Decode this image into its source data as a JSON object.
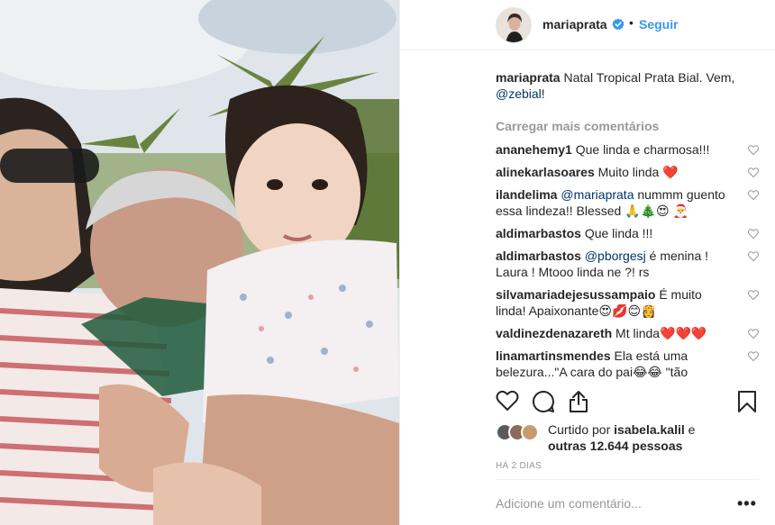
{
  "post": {
    "photo_alt": "family-selfie-photo",
    "header": {
      "username": "mariaprata",
      "dot": "•",
      "follow_label": "Seguir"
    },
    "caption": {
      "username": "mariaprata",
      "text": " Natal Tropical Prata Bial. Vem, ",
      "mention": "@zebial",
      "after": "!"
    },
    "load_more_label": "Carregar mais comentários",
    "comments": [
      {
        "user": "ananehemy1",
        "text": " Que linda e charmosa!!!"
      },
      {
        "user": "alinekarlasoares",
        "text": " Muito linda ❤️"
      },
      {
        "user": "ilandelima",
        "mention": " @mariaprata",
        "text": " nummm guento essa lindeza!! Blessed 🙏🎄😍 🎅"
      },
      {
        "user": "aldimarbastos",
        "text": " Que linda !!!"
      },
      {
        "user": "aldimarbastos",
        "mention": " @pborgesj",
        "text": " é menina ! Laura ! Mtooo linda ne ?! rs"
      },
      {
        "user": "silvamariadejesussampaio",
        "text": " É muito linda! Apaixonante😍💋😊👸"
      },
      {
        "user": "valdinezdenazareth",
        "text": " Mt linda❤️❤️❤️"
      },
      {
        "user": "linamartinsmendes",
        "text": " Ela está uma belezura...\"A cara do pai😂😂  \"tão"
      }
    ],
    "likes": {
      "prefix": "Curtido por ",
      "user": "isabela.kalil",
      "middle": " e",
      "count_text": "outras 12.644 pessoas"
    },
    "time_label": "HÁ 2 DIAS",
    "add_comment_placeholder": "Adicione um comentário...",
    "more_label": "•••",
    "colors": {
      "link_blue": "#3897f0",
      "mention_blue": "#003569",
      "text": "#262626",
      "muted": "#999999",
      "verified": "#3897f0",
      "heart_red": "#ed4956"
    },
    "icons": [
      "heart-icon",
      "comment-icon",
      "share-icon",
      "bookmark-icon",
      "verified-badge-icon",
      "more-options-icon"
    ]
  }
}
